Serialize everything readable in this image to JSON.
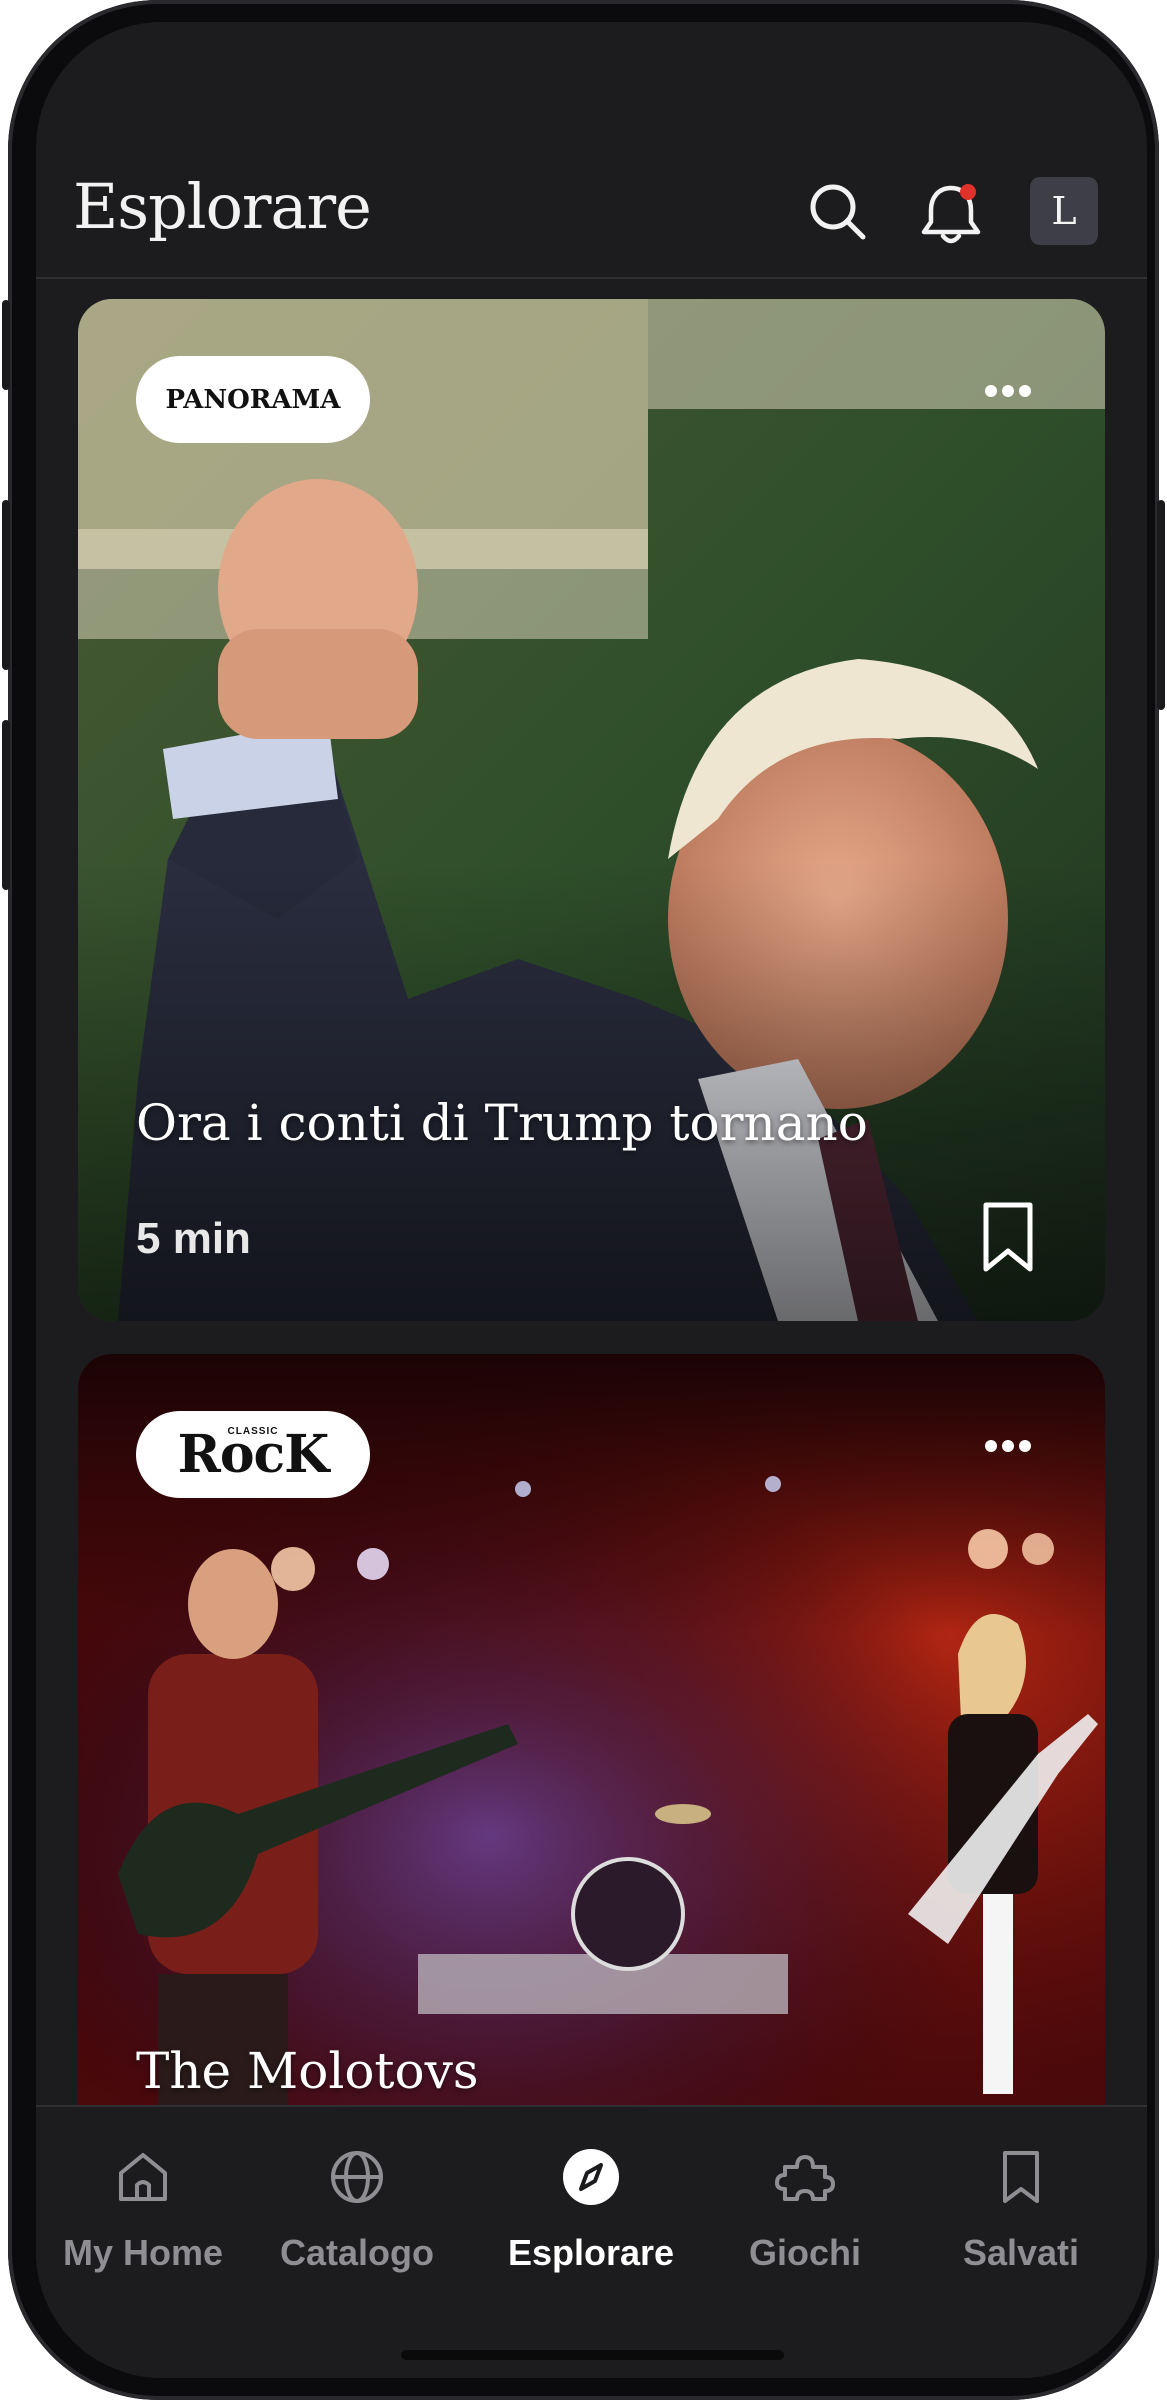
{
  "header": {
    "title": "Esplorare",
    "avatar_initial": "L"
  },
  "cards": [
    {
      "brand": "PANORAMA",
      "title": "Ora i conti di Trump tornano",
      "duration": "5 min"
    },
    {
      "brand_small": "CLASSIC",
      "brand": "RocK",
      "title": "The Molotovs"
    }
  ],
  "nav": {
    "items": [
      {
        "label": "My Home",
        "icon": "home-icon"
      },
      {
        "label": "Catalogo",
        "icon": "globe-icon"
      },
      {
        "label": "Esplorare",
        "icon": "compass-icon",
        "active": true
      },
      {
        "label": "Giochi",
        "icon": "puzzle-icon"
      },
      {
        "label": "Salvati",
        "icon": "bookmark-icon"
      }
    ]
  },
  "colors": {
    "background": "#1c1c1e",
    "notification_dot": "#e0322b",
    "inactive_nav": "#8e8e93"
  }
}
